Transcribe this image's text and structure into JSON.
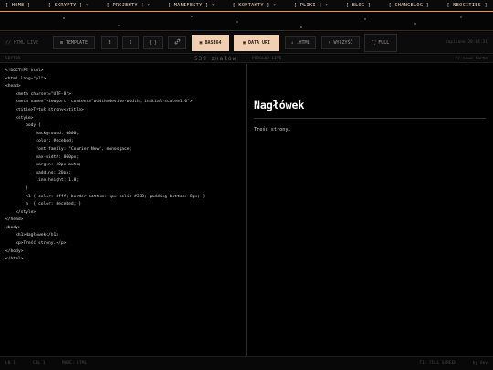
{
  "nav": {
    "items": [
      {
        "label": "[ HOME ]"
      },
      {
        "label": "[ SKRYPTY ] ▾"
      },
      {
        "label": "[ PROJEKTY ] ▾"
      },
      {
        "label": "[ MANIFESTY ] ▾"
      },
      {
        "label": "[ KONTAKTY ] ▾"
      },
      {
        "label": "[ PLIKI ] ▾"
      },
      {
        "label": "[ BLOG ]"
      },
      {
        "label": "[ CHANGELOG ]"
      },
      {
        "label": "[ NEOCITIES ]"
      }
    ]
  },
  "toolbar": {
    "live_label": "// HTML LIVE",
    "template_label": "TEMPLATE",
    "b_label": "B",
    "i_label": "I",
    "code_label": "{ }",
    "link_icon": "link-icon",
    "base64_label": "BASE64",
    "data_uri_label": "DATA URI",
    "html_label": ".HTML",
    "clear_label": "WYCZYŚĆ",
    "full_label": "FULL",
    "saved_label": "zapisano 20:04:31"
  },
  "strip": {
    "left_label": "EDYTOR",
    "chars": "539 znaków",
    "mid_label": "PODGLĄD LIVE",
    "right_label": "// nowa karta"
  },
  "editor": {
    "code": "<!DOCTYPE html>\n<html lang=\"pl\">\n<head>\n    <meta charset=\"UTF-8\">\n    <meta name=\"viewport\" content=\"width=device-width, initial-scale=1.0\">\n    <title>Tytuł strony</title>\n    <style>\n        body {\n            background: #000;\n            color: #ecebed;\n            font-family: \"Courier New\", monospace;\n            max-width: 800px;\n            margin: 40px auto;\n            padding: 20px;\n            line-height: 1.8;\n        }\n        h1 { color: #fff; border-bottom: 1px solid #333; padding-bottom: 8px; }\n        a  { color: #ecebed; }\n    </style>\n</head>\n<body>\n    <h1>Nagłówek</h1>\n    <p>Treść strony.</p>\n</body>\n</html>"
  },
  "preview": {
    "heading": "Nagłówek",
    "paragraph": "Treść strony."
  },
  "footer": {
    "ln": "LN 1",
    "col": "COL 1",
    "mode": "MODE: HTML",
    "right": "F1: FULL SCREEN",
    "author": "by dev"
  },
  "colors": {
    "accent": "#f1cfb3",
    "nav_border": "#c9a27a",
    "bg": "#000000",
    "text": "#ecebed"
  }
}
